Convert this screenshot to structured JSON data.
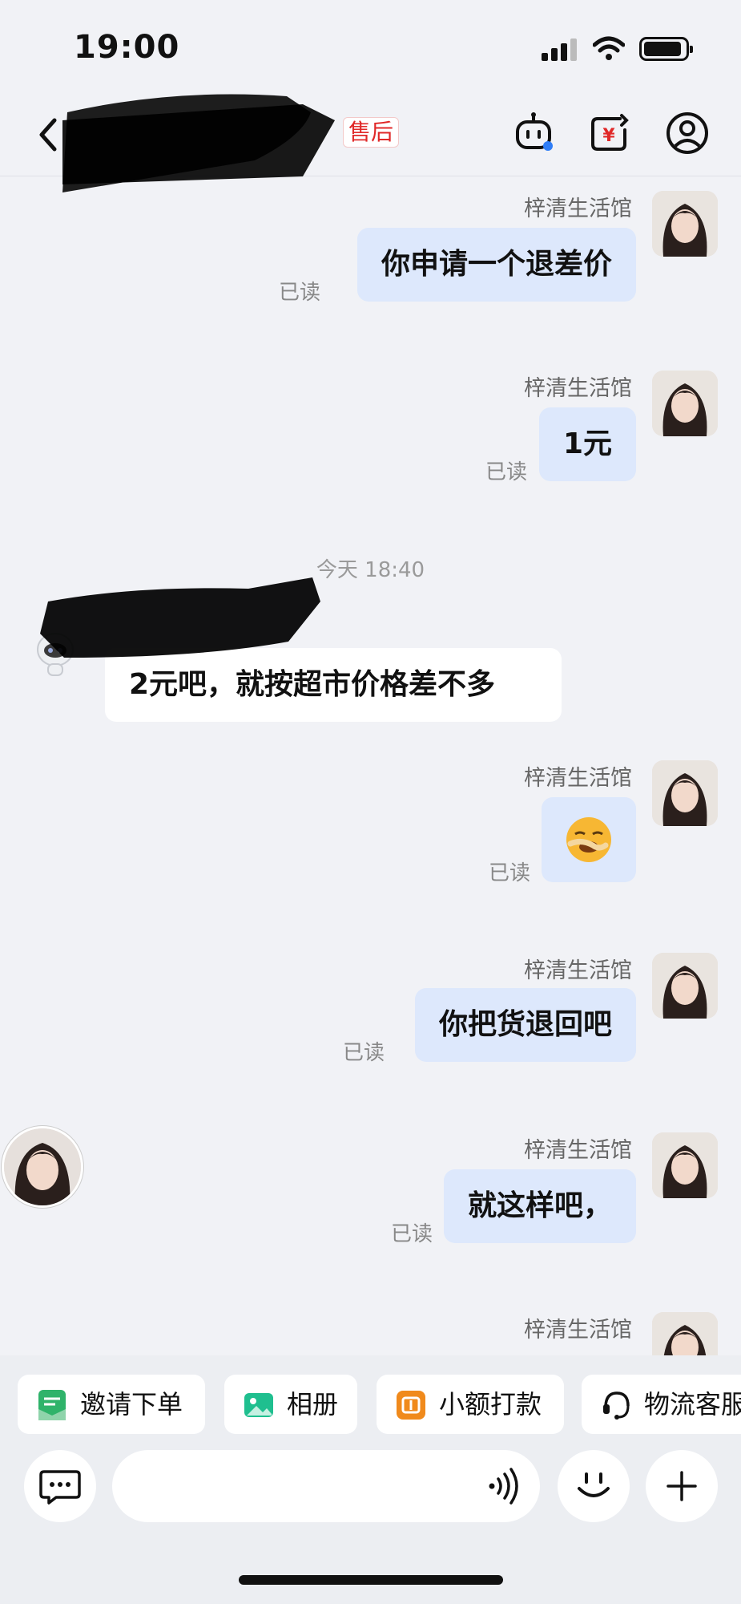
{
  "status_bar": {
    "time": "19:00"
  },
  "nav": {
    "after_sales_badge": "售后"
  },
  "messages": [
    {
      "sender": "梓清生活馆",
      "text": "你申请一个退差价",
      "read": "已读"
    },
    {
      "sender": "梓清生活馆",
      "text": "1元",
      "read": "已读"
    },
    {
      "sender": "梓清生活馆",
      "text": "",
      "emoji": "yawning-face-emoji",
      "read": "已读"
    },
    {
      "sender": "梓清生活馆",
      "text": "你把货退回吧",
      "read": "已读"
    },
    {
      "sender": "梓清生活馆",
      "text": "就这样吧，",
      "read": "已读"
    },
    {
      "sender": "梓清生活馆"
    }
  ],
  "timestamp": "今天 18:40",
  "incoming": {
    "text": "2元吧，就按超市价格差不多"
  },
  "shortcuts": [
    {
      "label": "邀请下单",
      "icon": "invite-order-icon",
      "color": "#2fb36a"
    },
    {
      "label": "相册",
      "icon": "album-icon",
      "color": "#1fbf8f"
    },
    {
      "label": "小额打款",
      "icon": "small-payment-icon",
      "color": "#f08a1c"
    },
    {
      "label": "物流客服",
      "icon": "logistics-service-icon",
      "color": "#111111"
    }
  ],
  "input": {
    "placeholder": ""
  }
}
